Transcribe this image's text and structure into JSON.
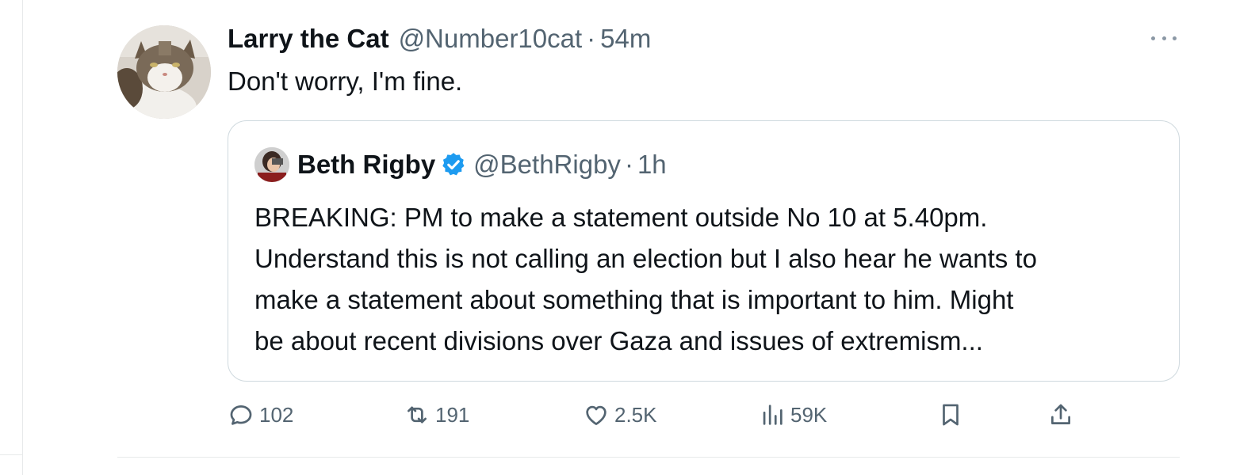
{
  "tweet": {
    "author_name": "Larry the Cat",
    "handle": "@Number10cat",
    "separator": "·",
    "time": "54m",
    "text": "Don't worry, I'm fine.",
    "avatar_icon": "cat-avatar"
  },
  "quoted": {
    "author_name": "Beth Rigby",
    "verified_icon": "verified-badge-icon",
    "verified_color": "#1d9bf0",
    "handle": "@BethRigby",
    "separator": "·",
    "time": "1h",
    "lines": [
      "BREAKING: PM to make a statement outside No 10 at 5.40pm.",
      "Understand this is not calling an election but I also hear he wants to",
      "make a statement about something that is important to him. Might",
      "be about recent divisions over Gaza and issues of extremism..."
    ]
  },
  "actions": {
    "replies": {
      "icon": "reply-icon",
      "count": "102"
    },
    "reposts": {
      "icon": "repost-icon",
      "count": "191"
    },
    "likes": {
      "icon": "heart-icon",
      "count": "2.5K"
    },
    "views": {
      "icon": "views-chart-icon",
      "count": "59K"
    },
    "bookmark": {
      "icon": "bookmark-icon"
    },
    "share": {
      "icon": "share-icon"
    }
  },
  "colors": {
    "text": "#0f1419",
    "muted": "#536471",
    "border": "#cfd9de"
  }
}
